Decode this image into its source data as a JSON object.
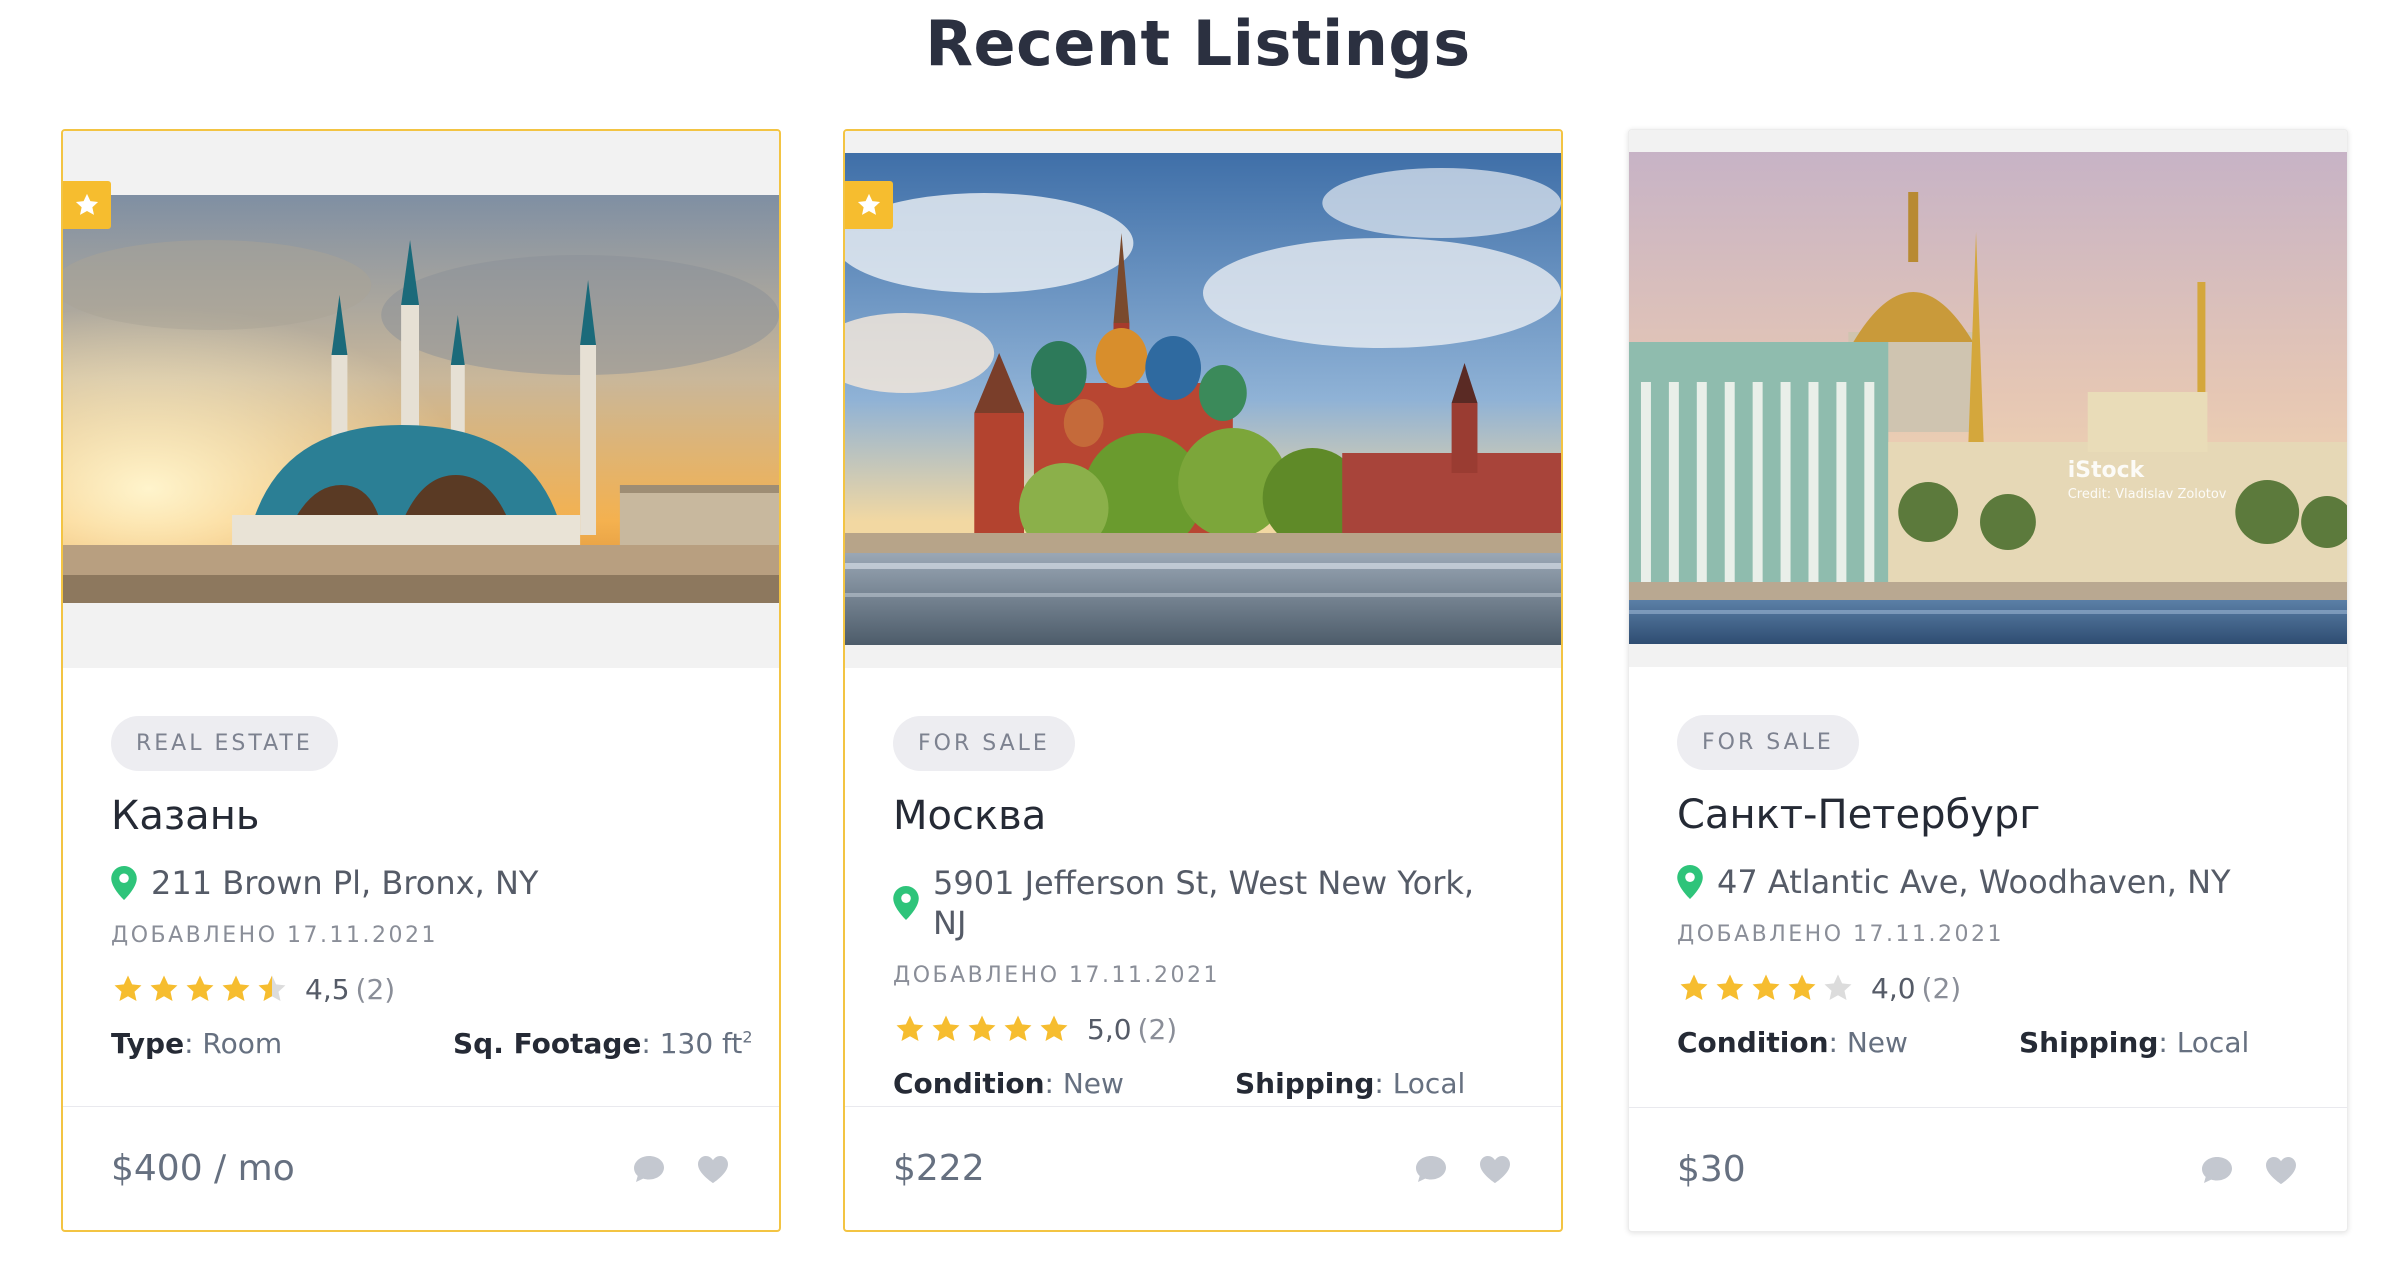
{
  "page": {
    "title": "Recent Listings"
  },
  "listings": [
    {
      "featured": true,
      "category": "REAL ESTATE",
      "title": "Казань",
      "address": "211 Brown Pl, Bronx, NY",
      "date": "ДОБАВЛЕНО 17.11.2021",
      "rating": 4.5,
      "rating_text": "4,5",
      "rating_count": "(2)",
      "spec1_label": "Type",
      "spec1_value": ": Room",
      "spec2_label": "Sq. Footage",
      "spec2_value": ": 130 ft",
      "spec2_sup": "2",
      "price": "$400 / mo",
      "image_alt": "Kul Sharif mosque at sunset"
    },
    {
      "featured": true,
      "category": "FOR SALE",
      "title": "Москва",
      "address": "5901 Jefferson St, West New York, NJ",
      "date": "ДОБАВЛЕНО 17.11.2021",
      "rating": 5,
      "rating_text": "5,0",
      "rating_count": "(2)",
      "spec1_label": "Condition",
      "spec1_value": ": New",
      "spec2_label": "Shipping",
      "spec2_value": ": Local",
      "spec2_sup": "",
      "price": "$222",
      "image_alt": "Saint Basil's Cathedral"
    },
    {
      "featured": false,
      "category": "FOR SALE",
      "title": "Санкт-Петербург",
      "address": "47 Atlantic Ave, Woodhaven, NY",
      "date": "ДОБАВЛЕНО 17.11.2021",
      "rating": 4,
      "rating_text": "4,0",
      "rating_count": "(2)",
      "spec1_label": "Condition",
      "spec1_value": ": New",
      "spec2_label": "Shipping",
      "spec2_value": ": Local",
      "spec2_sup": "",
      "price": "$30",
      "image_alt": "Saint Petersburg embankment",
      "watermark": "iStock",
      "watermark_credit": "Credit: Vladislav Zolotov"
    }
  ],
  "colors": {
    "accent": "#f6bd2f",
    "card_border_featured": "#f3c443",
    "star_on": "#f6bd2f",
    "star_off": "#dcdcdc",
    "pin": "#2ec47a",
    "icon_muted": "#c4c8d0"
  },
  "icons": {
    "featured": "star-icon",
    "location": "map-pin-icon",
    "comment": "chat-bubble-icon",
    "favorite": "heart-icon"
  }
}
